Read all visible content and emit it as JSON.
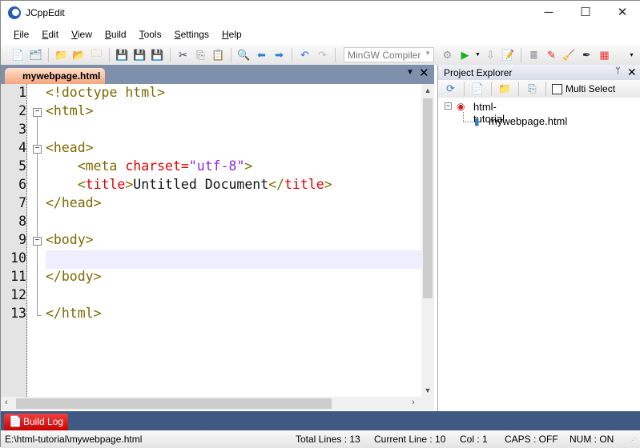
{
  "window": {
    "title": "JCppEdit",
    "minimize": "─",
    "maximize": "☐",
    "close": "✕"
  },
  "menu": [
    "File",
    "Edit",
    "View",
    "Build",
    "Tools",
    "Settings",
    "Help"
  ],
  "toolbar": {
    "compiler": "MinGW Compiler"
  },
  "editor": {
    "tab": "mywebpage.html",
    "tab_menu": "▼",
    "tab_close": "✕",
    "current_line": 10,
    "lines": [
      [
        [
          "tag",
          "<!doctype html>"
        ]
      ],
      [
        [
          "tag",
          "<html>"
        ]
      ],
      [],
      [
        [
          "tag",
          "<head>"
        ]
      ],
      [
        [
          "txt",
          "    "
        ],
        [
          "tag",
          "<meta "
        ],
        [
          "attr",
          "charset="
        ],
        [
          "val",
          "\"utf-8\""
        ],
        [
          "tag",
          ">"
        ]
      ],
      [
        [
          "txt",
          "    "
        ],
        [
          "tag",
          "<"
        ],
        [
          "tn",
          "title"
        ],
        [
          "tag",
          ">"
        ],
        [
          "txt",
          "Untitled Document"
        ],
        [
          "tag",
          "</"
        ],
        [
          "tn",
          "title"
        ],
        [
          "tag",
          ">"
        ]
      ],
      [
        [
          "tag",
          "</head>"
        ]
      ],
      [],
      [
        [
          "tag",
          "<body>"
        ]
      ],
      [],
      [
        [
          "tag",
          "</body>"
        ]
      ],
      [],
      [
        [
          "tag",
          "</html>"
        ]
      ]
    ],
    "folds": [
      2,
      4,
      9
    ]
  },
  "project_explorer": {
    "title": "Project Explorer",
    "pin": "📌",
    "close": "✕",
    "multi_select": "Multi Select",
    "multi_select_checked": false,
    "root": "html-tutorial",
    "files": [
      "mywebpage.html"
    ]
  },
  "build_log": {
    "label": "Build Log"
  },
  "status": {
    "path": "E:\\html-tutorial\\mywebpage.html",
    "total_lines": "Total Lines : 13",
    "current_line": "Current Line : 10",
    "col": "Col : 1",
    "caps": "CAPS : OFF",
    "num": "NUM : ON"
  }
}
